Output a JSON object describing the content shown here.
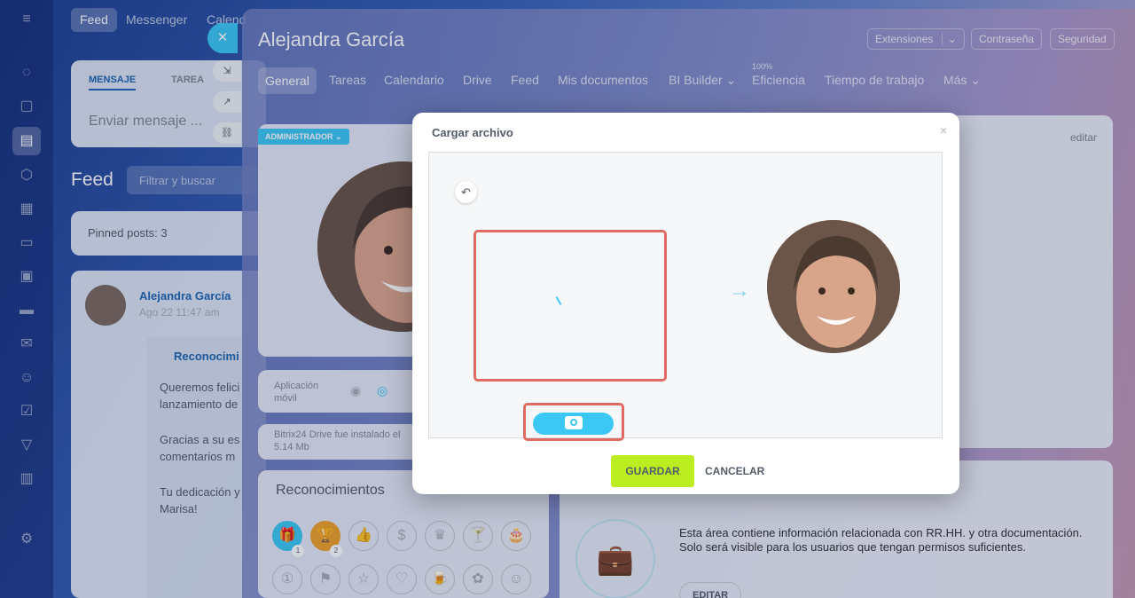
{
  "feed": {
    "tabs": [
      "Feed",
      "Messenger",
      "Calend"
    ],
    "composer_tabs": [
      "MENSAJE",
      "TAREA"
    ],
    "composer_placeholder": "Enviar mensaje ...",
    "title": "Feed",
    "filter_placeholder": "Filtrar y buscar",
    "pinned": "Pinned posts: 3",
    "post_author": "Alejandra García",
    "post_date": "Ago 22 11:47 am",
    "post_heading": "Reconocimi",
    "post_lines": [
      "Queremos felici",
      "lanzamiento de",
      "Gracias a su es",
      "comentarios m",
      "Tu dedicación y",
      "Marisa!"
    ]
  },
  "profile": {
    "name": "Alejandra García",
    "header_buttons": {
      "extensions": "Extensiones",
      "password": "Contraseña",
      "security": "Seguridad"
    },
    "tabs": [
      "General",
      "Tareas",
      "Calendario",
      "Drive",
      "Feed",
      "Mis documentos",
      "BI Builder",
      "Eficiencia",
      "Tiempo de trabajo",
      "Más"
    ],
    "efficiency_badge": "100%",
    "admin_badge": "ADMINISTRADOR",
    "edit_link": "editar",
    "mobile_app": "Aplicación móvil",
    "drive_info": "Bitrix24 Drive fue instalado el",
    "drive_size": "5.14 Mb",
    "recognitions_title": "Reconocimientos",
    "badge_counts": [
      "1",
      "2"
    ],
    "hr_text": "Esta área contiene información relacionada con RR.HH. y otra documentación. Solo será visible para los usuarios que tengan permisos suficientes.",
    "hr_edit": "EDITAR"
  },
  "dialog": {
    "title": "Cargar archivo",
    "close": "×",
    "save": "GUARDAR",
    "cancel": "CANCELAR"
  },
  "colors": {
    "accent": "#3bc8f5",
    "save": "#bbed21",
    "highlight": "#e06b63"
  }
}
